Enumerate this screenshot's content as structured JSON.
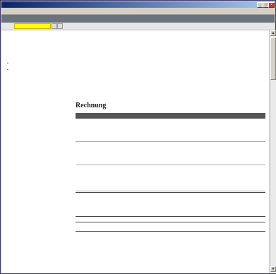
{
  "window": {
    "title": "",
    "minimize": "_",
    "maximize": "□",
    "close": "×"
  },
  "menu": [
    "",
    "",
    "",
    "",
    ""
  ],
  "nav": {
    "text": ""
  },
  "search": {
    "label": "",
    "value": "",
    "go": "",
    "next": "",
    "crumb": "",
    "logout": ""
  },
  "sidebar": {
    "active": "",
    "links": [
      "",
      ""
    ]
  },
  "meta": {
    "date_label": "",
    "date_value": "",
    "customer_label": "",
    "customer_value": "",
    "invoice_label": "",
    "invoice_value": ""
  },
  "address": [
    "",
    "",
    "",
    "",
    ""
  ],
  "invoice": {
    "heading": "Rechnung",
    "columns": [
      "",
      "",
      "",
      "",
      ""
    ],
    "rows": [
      {
        "title": "",
        "lines": [
          "",
          "",
          ""
        ],
        "qty": "",
        "unit": "",
        "price": "",
        "total": "",
        "status": ""
      },
      {
        "title": "",
        "lines": [
          "",
          ""
        ],
        "qty": "",
        "unit": "",
        "price": "",
        "total": "",
        "status": ""
      },
      {
        "title": "",
        "lines": [
          "",
          "",
          ""
        ],
        "qty": "",
        "unit": "",
        "price": "",
        "old_price": "",
        "total": "",
        "status": ""
      }
    ],
    "subtotal_label": "",
    "subtotal_value": "",
    "summary": [
      {
        "label": "",
        "value": ""
      },
      {
        "label": "",
        "value": ""
      },
      {
        "label": "",
        "value": ""
      },
      {
        "label": "",
        "value": ""
      }
    ],
    "grand_label": "",
    "grand_value": ""
  },
  "footer": {
    "delivery_label": "",
    "delivery_lines": [
      "",
      ""
    ],
    "payment_label": "",
    "payment_value": "",
    "notes_label": ""
  },
  "colors": {
    "accent": "#cc3333",
    "nav": "#6d737a",
    "search_highlight": "#ffff00",
    "ok": "#2a9a2a"
  }
}
